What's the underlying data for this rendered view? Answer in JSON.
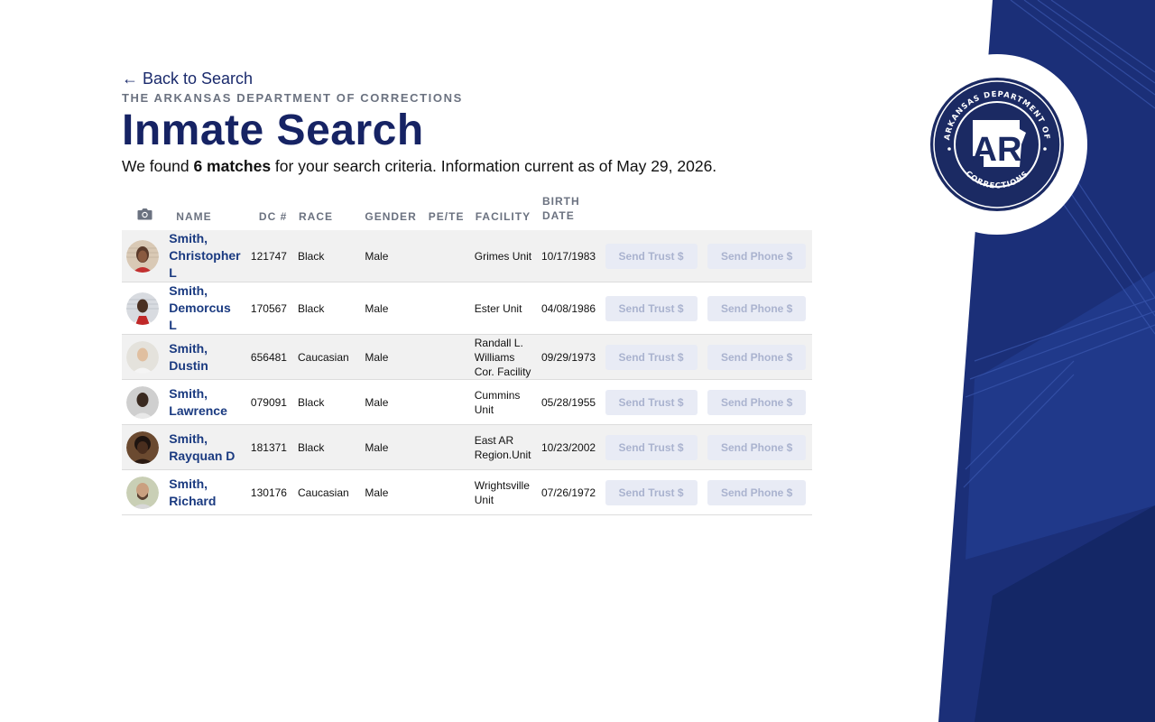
{
  "header": {
    "back_link": "← Back to Search",
    "department": "THE ARKANSAS DEPARTMENT OF CORRECTIONS",
    "title": "Inmate Search",
    "subtitle_prefix": "We found ",
    "match_count": "6 matches",
    "subtitle_suffix": " for your search criteria. Information current as of May 29, 2026."
  },
  "seal": {
    "ring_text_top": "ARKANSAS DEPARTMENT OF",
    "ring_text_bottom": "CORRECTIONS",
    "center": "AR"
  },
  "colors": {
    "navy": "#162364",
    "link": "#1a3a80",
    "button_bg": "#e8ebf5",
    "button_text": "#aab3cf"
  },
  "table": {
    "columns": [
      "camera-icon",
      "NAME",
      "DC #",
      "RACE",
      "GENDER",
      "PE/TE",
      "FACILITY",
      "BIRTH DATE"
    ],
    "headers": {
      "name": "NAME",
      "dc": "DC #",
      "race": "RACE",
      "gender": "GENDER",
      "pete": "PE/TE",
      "facility": "FACILITY",
      "birth_line1": "BIRTH",
      "birth_line2": "DATE"
    },
    "trust_label": "Send Trust $",
    "phone_label": "Send Phone $",
    "rows": [
      {
        "name_line1": "Smith,",
        "name_line2": "Christopher",
        "name_line3": "L",
        "dc": "121747",
        "race": "Black",
        "gender": "Male",
        "pete": "",
        "facility_line1": "Grimes Unit",
        "facility_line2": "",
        "facility_line3": "",
        "birth_date": "10/17/1983"
      },
      {
        "name_line1": "Smith,",
        "name_line2": "Demorcus",
        "name_line3": "L",
        "dc": "170567",
        "race": "Black",
        "gender": "Male",
        "pete": "",
        "facility_line1": "Ester Unit",
        "facility_line2": "",
        "facility_line3": "",
        "birth_date": "04/08/1986"
      },
      {
        "name_line1": "Smith,",
        "name_line2": "Dustin",
        "name_line3": "",
        "dc": "656481",
        "race": "Caucasian",
        "gender": "Male",
        "pete": "",
        "facility_line1": "Randall L.",
        "facility_line2": "Williams",
        "facility_line3": "Cor. Facility",
        "birth_date": "09/29/1973"
      },
      {
        "name_line1": "Smith,",
        "name_line2": "Lawrence",
        "name_line3": "",
        "dc": "079091",
        "race": "Black",
        "gender": "Male",
        "pete": "",
        "facility_line1": "Cummins",
        "facility_line2": "Unit",
        "facility_line3": "",
        "birth_date": "05/28/1955"
      },
      {
        "name_line1": "Smith,",
        "name_line2": "Rayquan D",
        "name_line3": "",
        "dc": "181371",
        "race": "Black",
        "gender": "Male",
        "pete": "",
        "facility_line1": "East AR",
        "facility_line2": "Region.Unit",
        "facility_line3": "",
        "birth_date": "10/23/2002"
      },
      {
        "name_line1": "Smith,",
        "name_line2": "Richard",
        "name_line3": "",
        "dc": "130176",
        "race": "Caucasian",
        "gender": "Male",
        "pete": "",
        "facility_line1": "Wrightsville",
        "facility_line2": "Unit",
        "facility_line3": "",
        "birth_date": "07/26/1972"
      }
    ]
  }
}
